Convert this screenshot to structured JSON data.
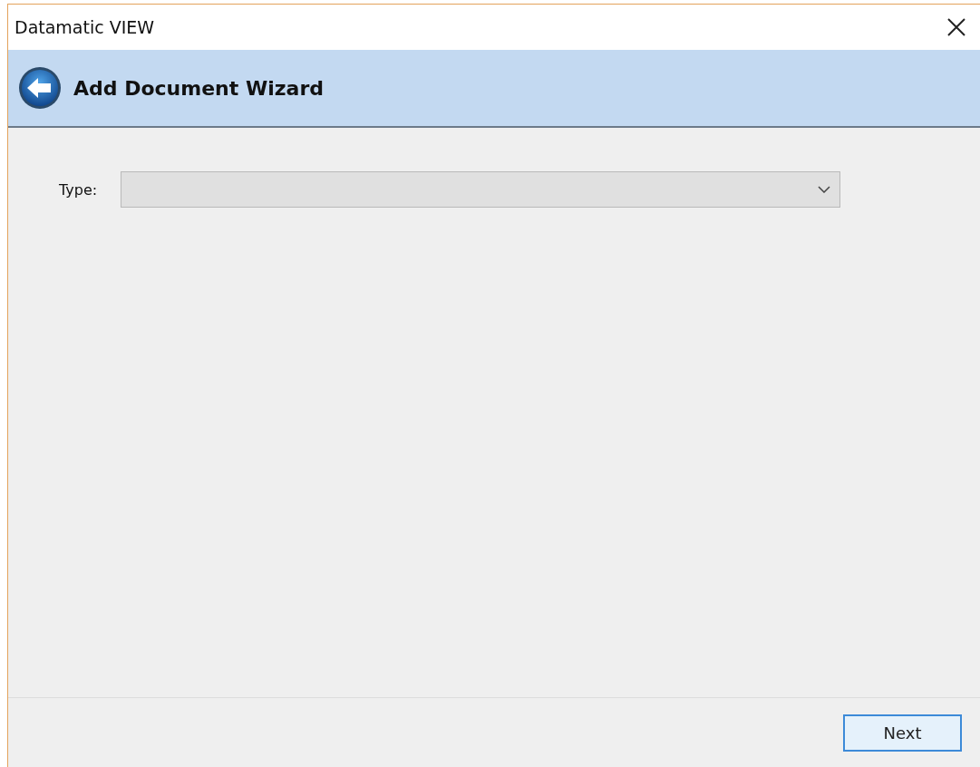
{
  "window": {
    "title": "Datamatic VIEW"
  },
  "header": {
    "title": "Add Document Wizard"
  },
  "form": {
    "type_field": {
      "label": "Type:",
      "disabled": true
    }
  },
  "buttons": [
    {
      "label": "Next"
    }
  ]
}
